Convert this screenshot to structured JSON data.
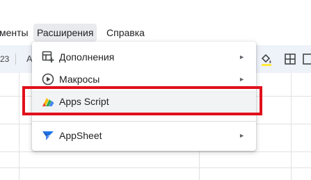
{
  "menubar": {
    "items": [
      {
        "label": "менты",
        "active": false
      },
      {
        "label": "Расширения",
        "active": true
      },
      {
        "label": "Справка",
        "active": false
      }
    ]
  },
  "toolbar": {
    "zoom_fragment": "23",
    "font_fragment": "А"
  },
  "extensions_menu": {
    "items": [
      {
        "label": "Дополнения",
        "icon": "add-ons-icon",
        "has_submenu": true
      },
      {
        "label": "Макросы",
        "icon": "macros-play-icon",
        "has_submenu": true
      },
      {
        "label": "Apps Script",
        "icon": "apps-script-logo-icon",
        "has_submenu": false
      },
      {
        "label": "AppSheet",
        "icon": "appsheet-logo-icon",
        "has_submenu": true
      }
    ],
    "submenu_arrow": "►"
  },
  "colors": {
    "highlight_border": "#e0101b",
    "toolbar_bg": "#eef2f9",
    "appsheet_blue": "#1a73e8"
  }
}
